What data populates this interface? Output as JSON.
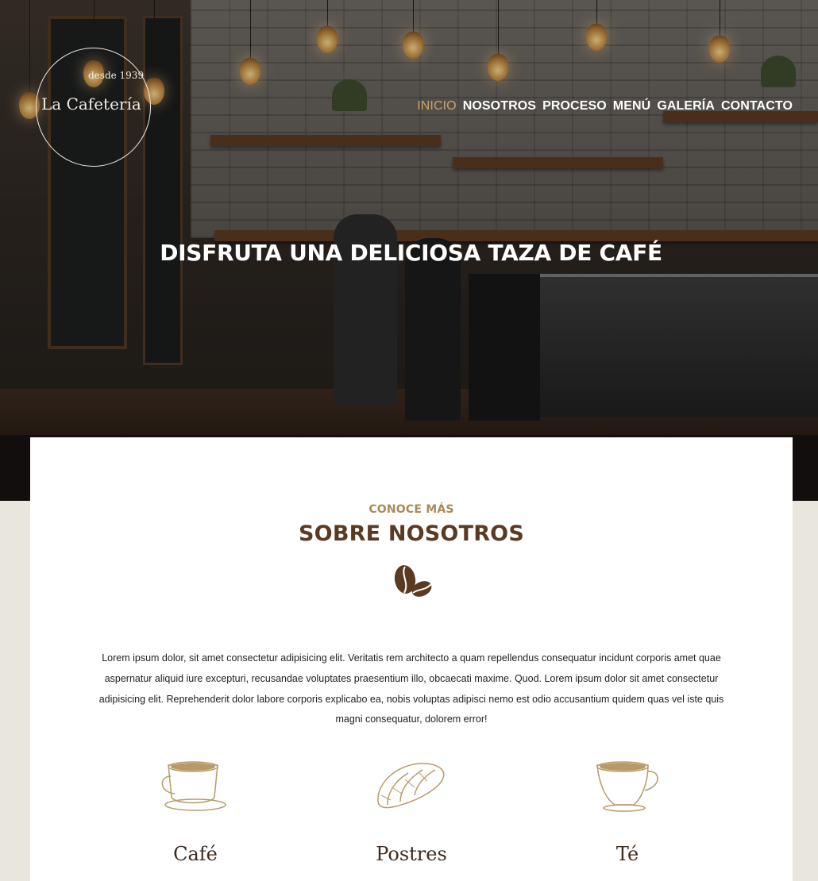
{
  "brand": {
    "since": "desde 1939",
    "name": "La Cafetería"
  },
  "nav": {
    "items": [
      {
        "label": "INICIO",
        "active": true
      },
      {
        "label": "NOSOTROS",
        "active": false
      },
      {
        "label": "PROCESO",
        "active": false
      },
      {
        "label": "MENÚ",
        "active": false
      },
      {
        "label": "GALERÍA",
        "active": false
      },
      {
        "label": "CONTACTO",
        "active": false
      }
    ]
  },
  "hero": {
    "title": "DISFRUTA UNA DELICIOSA TAZA DE CAFÉ"
  },
  "about": {
    "eyebrow": "CONOCE MÁS",
    "title": "SOBRE NOSOTROS",
    "icon": "coffee-beans-icon",
    "text": "Lorem ipsum dolor, sit amet consectetur adipisicing elit. Veritatis rem architecto a quam repellendus consequatur incidunt corporis amet quae aspernatur aliquid iure excepturi, recusandae voluptates praesentium illo, obcaecati maxime. Quod. Lorem ipsum dolor sit amet consectetur adipisicing elit. Reprehenderit dolor labore corporis explicabo ea, nobis voluptas adipisci nemo est odio accusantium quidem quas vel iste quis magni consequatur, dolorem error!"
  },
  "features": [
    {
      "label": "Café",
      "icon": "coffee-cup-icon"
    },
    {
      "label": "Postres",
      "icon": "croissant-icon"
    },
    {
      "label": "Té",
      "icon": "tea-cup-icon"
    }
  ],
  "colors": {
    "accent": "#c9a46b",
    "title_brown": "#5a3a23",
    "page_bg": "#e9e6de"
  }
}
